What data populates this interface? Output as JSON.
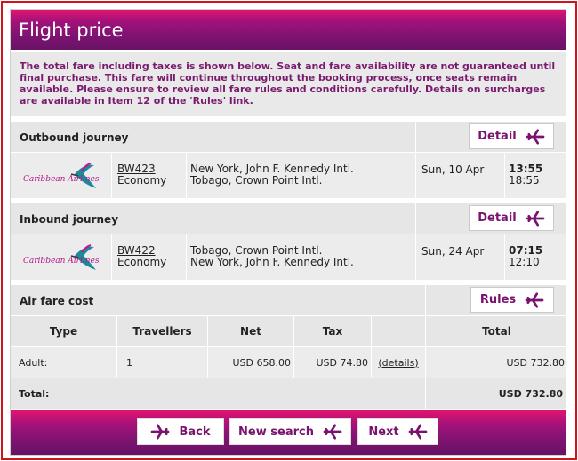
{
  "header": {
    "title": "Flight price"
  },
  "intro": {
    "text": "The total fare including taxes is shown below. Seat and fare availability are not guaranteed until final purchase. This fare will continue throughout the booking process, once seats remain available. Please ensure to review all fare rules and conditions carefully. Details on surcharges are available in Item 12 of the 'Rules' link."
  },
  "airline": {
    "name": "Caribbean Airlines"
  },
  "outbound": {
    "title": "Outbound journey",
    "detail_label": "Detail",
    "flight_number": "BW423",
    "cabin": "Economy",
    "from": "New York, John F. Kennedy Intl.",
    "to": "Tobago, Crown Point Intl.",
    "date": "Sun, 10 Apr",
    "depart_time": "13:55",
    "arrive_time": "18:55"
  },
  "inbound": {
    "title": "Inbound journey",
    "detail_label": "Detail",
    "flight_number": "BW422",
    "cabin": "Economy",
    "from": "Tobago, Crown Point Intl.",
    "to": "New York, John F. Kennedy Intl.",
    "date": "Sun, 24 Apr",
    "depart_time": "07:15",
    "arrive_time": "12:10"
  },
  "fare": {
    "title": "Air fare cost",
    "rules_label": "Rules",
    "columns": {
      "type": "Type",
      "travellers": "Travellers",
      "net": "Net",
      "tax": "Tax",
      "total": "Total"
    },
    "rows": [
      {
        "type": "Adult:",
        "travellers": "1",
        "net": "USD 658.00",
        "tax": "USD 74.80",
        "details_label": "(details)",
        "total": "USD 732.80"
      }
    ],
    "total_label": "Total:",
    "total_value": "USD 732.80"
  },
  "footer": {
    "back_label": "Back",
    "new_search_label": "New search",
    "next_label": "Next"
  },
  "colors": {
    "brand": "#7a136f",
    "accent": "#e01470",
    "frame": "#d0141c"
  }
}
